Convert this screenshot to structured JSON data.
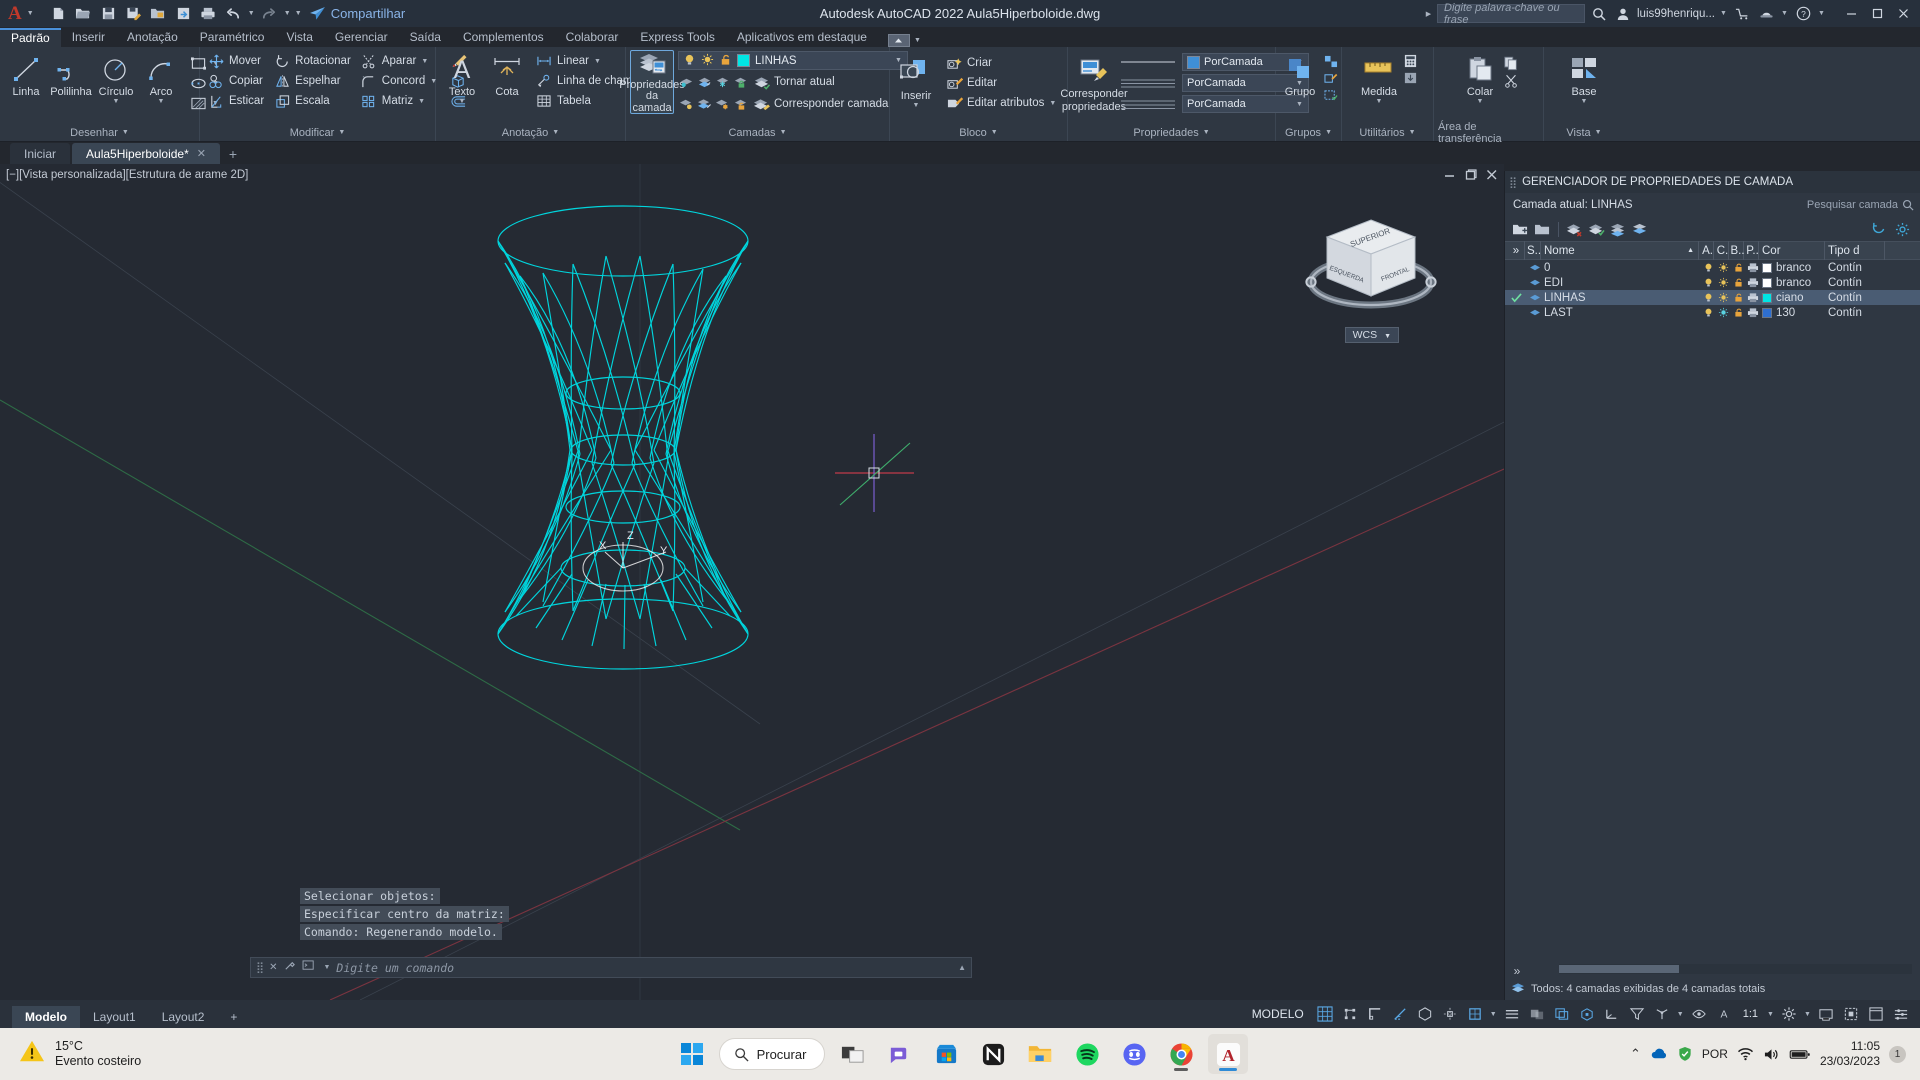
{
  "titlebar": {
    "app_logo": "autocad-a-logo",
    "quick_access": [
      {
        "name": "new-file",
        "icon": "new-doc-icon"
      },
      {
        "name": "open-file",
        "icon": "folder-open-icon"
      },
      {
        "name": "save",
        "icon": "floppy-save-icon"
      },
      {
        "name": "save-as",
        "icon": "save-as-icon"
      },
      {
        "name": "open-from-web",
        "icon": "cloud-folder-icon"
      },
      {
        "name": "save-to-web",
        "icon": "cloud-save-icon"
      },
      {
        "name": "plot",
        "icon": "printer-icon"
      },
      {
        "name": "undo",
        "icon": "undo-arrow-icon"
      },
      {
        "name": "redo",
        "icon": "redo-arrow-icon"
      }
    ],
    "share_label": "Compartilhar",
    "title": "Autodesk AutoCAD 2022    Aula5Hiperboloide.dwg",
    "search_placeholder": "Digite palavra-chave ou frase",
    "username": "luis99henriqu...",
    "window_controls": {
      "minimize": "—",
      "maximize": "❐",
      "close": "✕"
    }
  },
  "ribbon_tabs": [
    {
      "label": "Padrão",
      "active": true
    },
    {
      "label": "Inserir",
      "active": false
    },
    {
      "label": "Anotação",
      "active": false
    },
    {
      "label": "Paramétrico",
      "active": false
    },
    {
      "label": "Vista",
      "active": false
    },
    {
      "label": "Gerenciar",
      "active": false
    },
    {
      "label": "Saída",
      "active": false
    },
    {
      "label": "Complementos",
      "active": false
    },
    {
      "label": "Colaborar",
      "active": false
    },
    {
      "label": "Express Tools",
      "active": false
    },
    {
      "label": "Aplicativos em destaque",
      "active": false
    }
  ],
  "panels": {
    "desenhar": {
      "title": "Desenhar",
      "big": [
        {
          "label": "Linha",
          "icon": "line-icon"
        },
        {
          "label": "Polilinha",
          "icon": "polyline-icon"
        },
        {
          "label": "Círculo",
          "icon": "circle-icon",
          "dropdown": true
        },
        {
          "label": "Arco",
          "icon": "arc-icon",
          "dropdown": true
        }
      ],
      "small": [
        {
          "icon": "rectangle-icon",
          "name": "rectangle-tool"
        },
        {
          "icon": "ellipse-icon",
          "name": "ellipse-tool"
        },
        {
          "icon": "hatch-icon",
          "name": "hatch-tool"
        }
      ]
    },
    "modificar": {
      "title": "Modificar",
      "items": [
        {
          "label": "Mover",
          "icon": "move-icon"
        },
        {
          "label": "Rotacionar",
          "icon": "rotate-icon"
        },
        {
          "label": "Aparar",
          "icon": "trim-icon",
          "dropdown": true
        },
        {
          "label": "Copiar",
          "icon": "copy-icon"
        },
        {
          "label": "Espelhar",
          "icon": "mirror-icon"
        },
        {
          "label": "Concord",
          "icon": "fillet-icon",
          "dropdown": true
        },
        {
          "label": "Esticar",
          "icon": "stretch-icon"
        },
        {
          "label": "Escala",
          "icon": "scale-icon"
        },
        {
          "label": "Matriz",
          "icon": "array-icon",
          "dropdown": true
        }
      ],
      "extras": [
        {
          "icon": "erase-icon",
          "name": "erase-tool"
        },
        {
          "icon": "extrude-3d-icon",
          "name": "3d-solid-tool"
        },
        {
          "icon": "offset-icon",
          "name": "offset-tool"
        }
      ]
    },
    "anotacao": {
      "title": "Anotação",
      "big": [
        {
          "label": "Texto",
          "icon": "text-a-icon",
          "dropdown": true
        },
        {
          "label": "Cota",
          "icon": "dimension-icon"
        }
      ],
      "small": [
        {
          "label": "Linear",
          "icon": "linear-dim-icon",
          "dropdown": true
        },
        {
          "label": "Linha de chamada",
          "icon": "leader-icon",
          "dropdown": true
        },
        {
          "label": "Tabela",
          "icon": "table-icon"
        }
      ]
    },
    "camadas": {
      "title": "Camadas",
      "big": {
        "label": "Propriedades\nda camada",
        "line1": "Propriedades",
        "line2": "da camada",
        "icon": "layer-properties-icon",
        "framed": true
      },
      "current_layer": "LINHAS",
      "current_layer_color": "#00e5e5",
      "row_icons_1": [
        {
          "name": "layer-isolate-icon"
        },
        {
          "name": "layer-unisolate-icon"
        },
        {
          "name": "layer-freeze-icon"
        },
        {
          "name": "layer-lock-icon"
        }
      ],
      "row_icons_2": [
        {
          "name": "layer-turn-off-icon"
        },
        {
          "name": "layer-turn-on-icon"
        },
        {
          "name": "layer-thaw-icon"
        },
        {
          "name": "layer-unlock-icon"
        }
      ],
      "make_current_label": "Tornar atual",
      "match_layer_label": "Corresponder camada"
    },
    "bloco": {
      "title": "Bloco",
      "big": {
        "label": "Inserir",
        "icon": "insert-block-icon",
        "dropdown": true
      },
      "items": [
        {
          "label": "Criar",
          "icon": "create-block-icon"
        },
        {
          "label": "Editar",
          "icon": "edit-block-icon"
        },
        {
          "label": "Editar atributos",
          "icon": "edit-attributes-icon",
          "dropdown": true
        }
      ]
    },
    "propriedades": {
      "title": "Propriedades",
      "big": {
        "line1": "Corresponder",
        "line2": "propriedades",
        "icon": "match-properties-icon"
      },
      "color_value": "PorCamada",
      "linetype_value": "PorCamada",
      "lineweight_value": "PorCamada",
      "color_swatch": "#3f8fd6"
    },
    "grupos": {
      "title": "Grupos",
      "big": {
        "label": "Grupo",
        "icon": "group-icon"
      }
    },
    "utilitarios": {
      "title": "Utilitários",
      "big": {
        "label": "Medida",
        "icon": "measure-icon",
        "dropdown": true
      }
    },
    "transferencia": {
      "title": "Área de transferência",
      "big": {
        "label": "Colar",
        "icon": "paste-icon",
        "dropdown": true
      },
      "small": [
        {
          "name": "copy-clip-icon"
        },
        {
          "name": "cut-clip-icon"
        }
      ]
    },
    "vista": {
      "title": "Vista",
      "big": {
        "label": "Base",
        "icon": "base-view-icon",
        "dropdown": true
      }
    }
  },
  "doctabs": [
    {
      "label": "Iniciar",
      "active": false,
      "closable": false
    },
    {
      "label": "Aula5Hiperboloide*",
      "active": true,
      "closable": true
    }
  ],
  "doctab_add": "+",
  "canvas": {
    "viewport_label": "[−][Vista personalizada][Estrutura de arame 2D]",
    "controls": {
      "minimize": "—",
      "restore": "❐",
      "close": "✕"
    },
    "viewcube": {
      "top_face": "SUPERIOR",
      "left_face": "ESQUERDA",
      "right_face": "FRONTAL"
    },
    "wcs_label": "WCS",
    "model_color": "#00d5dd",
    "command_history": [
      "Selecionar objetos:",
      "Especificar centro da matriz:",
      "Comando:  Regenerando modelo."
    ],
    "command_placeholder": "Digite um comando",
    "ucs_axes": {
      "x": "X",
      "y": "Y",
      "z": "Z"
    }
  },
  "layer_palette": {
    "title": "GERENCIADOR DE PROPRIEDADES DE CAMADA",
    "current_layer_text": "Camada atual: LINHAS",
    "search_placeholder": "Pesquisar camada",
    "toolbar_icons": [
      {
        "name": "new-layer-icon"
      },
      {
        "name": "new-layer-vp-frozen-icon"
      },
      {
        "name": "delete-layer-icon"
      },
      {
        "name": "set-current-layer-icon"
      },
      {
        "name": "layer-states-icon"
      },
      {
        "name": "layer-filter-icon"
      }
    ],
    "right_icons": [
      {
        "name": "refresh-icon"
      },
      {
        "name": "settings-gear-icon"
      }
    ],
    "columns": [
      "S..",
      "Nome",
      "A.",
      "C.",
      "B..",
      "P..",
      "Cor",
      "Tipo d"
    ],
    "rows": [
      {
        "status": "layer-icon",
        "name": "0",
        "on": true,
        "freeze": true,
        "lock": true,
        "plot": true,
        "color_name": "branco",
        "color_hex": "#ffffff",
        "linetype": "Contín",
        "selected": false,
        "checked": false
      },
      {
        "status": "layer-icon",
        "name": "EDI",
        "on": true,
        "freeze": true,
        "lock": true,
        "plot": true,
        "color_name": "branco",
        "color_hex": "#ffffff",
        "linetype": "Contín",
        "selected": false,
        "checked": false
      },
      {
        "status": "layer-icon",
        "name": "LINHAS",
        "on": true,
        "freeze": true,
        "lock": true,
        "plot": true,
        "color_name": "ciano",
        "color_hex": "#00e5e5",
        "linetype": "Contín",
        "selected": true,
        "checked": true
      },
      {
        "status": "layer-icon",
        "name": "LAST",
        "on": true,
        "freeze": true,
        "lock": true,
        "plot": true,
        "color_name": "130",
        "color_hex": "#2f6fd0",
        "linetype": "Contín",
        "selected": false,
        "checked": false
      }
    ],
    "status_text": "Todos: 4 camadas exibidas de 4 camadas totais",
    "expand_icon": "»"
  },
  "statusbar": {
    "layout_tabs": [
      {
        "label": "Modelo",
        "active": true
      },
      {
        "label": "Layout1",
        "active": false
      },
      {
        "label": "Layout2",
        "active": false
      }
    ],
    "add_layout": "+",
    "space_label": "MODELO",
    "scale": "1:1",
    "icons": [
      {
        "name": "grid-display-icon",
        "on": true
      },
      {
        "name": "snap-mode-icon",
        "on": false
      },
      {
        "name": "ortho-mode-icon",
        "on": false
      },
      {
        "name": "polar-tracking-icon",
        "on": true
      },
      {
        "name": "isometric-draft-icon",
        "on": false
      },
      {
        "name": "object-snap-tracking-icon",
        "on": false
      },
      {
        "name": "object-snap-icon",
        "on": true
      },
      {
        "name": "lineweight-icon",
        "on": false
      },
      {
        "name": "transparency-icon",
        "on": true
      },
      {
        "name": "selection-cycling-icon",
        "on": false
      },
      {
        "name": "3d-object-snap-icon",
        "on": false
      },
      {
        "name": "dynamic-ucs-icon",
        "on": false
      },
      {
        "name": "selection-filter-icon",
        "on": false
      },
      {
        "name": "gizmo-icon",
        "on": false
      },
      {
        "name": "annotation-visibility-icon",
        "on": false
      },
      {
        "name": "autoscale-icon",
        "on": false
      },
      {
        "name": "annotation-scale-icon",
        "on": false
      },
      {
        "name": "workspace-switch-icon",
        "on": false
      },
      {
        "name": "hardware-accel-icon",
        "on": false
      },
      {
        "name": "isolate-objects-icon",
        "on": false
      },
      {
        "name": "clean-screen-icon",
        "on": false
      },
      {
        "name": "customization-icon",
        "on": false
      }
    ]
  },
  "taskbar": {
    "weather": {
      "temp": "15°C",
      "desc": "Evento costeiro",
      "icon": "warning-triangle-icon"
    },
    "start": {
      "name": "windows-start-icon"
    },
    "search": {
      "label": "Procurar",
      "icon": "search-icon"
    },
    "apps": [
      {
        "name": "task-view-icon",
        "running": false
      },
      {
        "name": "microsoft-teams-icon",
        "running": false
      },
      {
        "name": "microsoft-store-icon",
        "running": false
      },
      {
        "name": "nvidia-app-icon",
        "running": false
      },
      {
        "name": "file-explorer-icon",
        "running": false
      },
      {
        "name": "spotify-icon",
        "running": false
      },
      {
        "name": "discord-icon",
        "running": false
      },
      {
        "name": "google-chrome-icon",
        "running": true
      },
      {
        "name": "autocad-icon",
        "running": true,
        "focused": true
      }
    ],
    "tray": {
      "chevron": "⌃",
      "icons": [
        {
          "name": "onedrive-icon"
        },
        {
          "name": "security-shield-icon"
        },
        {
          "name": "language-indicator",
          "label": "POR"
        },
        {
          "name": "wifi-icon"
        },
        {
          "name": "volume-icon"
        },
        {
          "name": "battery-icon"
        }
      ],
      "time": "11:05",
      "date": "23/03/2023",
      "notification_count": "1"
    }
  }
}
